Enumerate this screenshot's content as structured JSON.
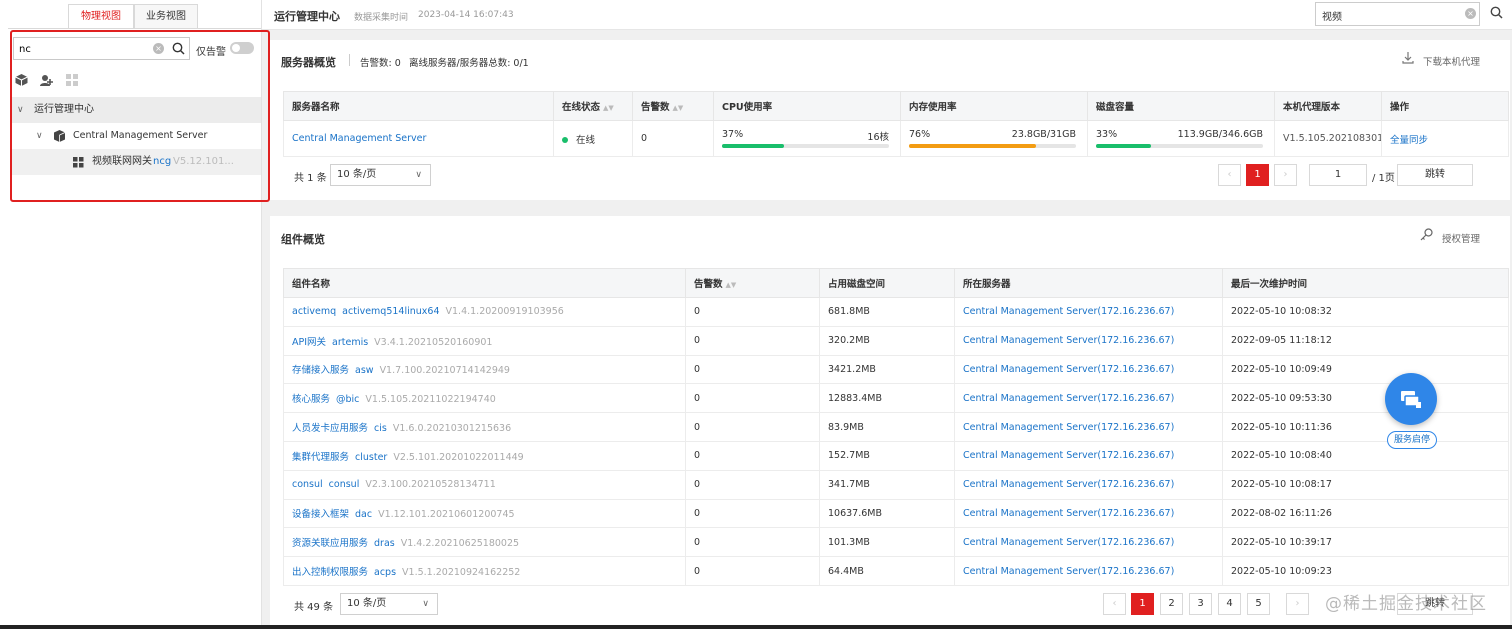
{
  "sidebar": {
    "tabs": [
      {
        "label": "物理视图",
        "active": true
      },
      {
        "label": "业务视图",
        "active": false
      }
    ],
    "search_value": "nc",
    "alert_only_label": "仅告警",
    "tree": {
      "root": "运行管理中心",
      "server": "Central Management Server",
      "gateway": {
        "name": "视频联网网关",
        "code": "ncg",
        "version": "V5.12.101..."
      }
    }
  },
  "header": {
    "title": "运行管理中心",
    "time_label": "数据采集时间",
    "time_value": "2023-04-14 16:07:43",
    "search_value": "视频"
  },
  "server_overview": {
    "title": "服务器概览",
    "alert_count": "告警数: 0",
    "offline_count": "离线服务器/服务器总数: 0/1",
    "download_label": "下载本机代理",
    "columns": [
      "服务器名称",
      "在线状态",
      "告警数",
      "CPU使用率",
      "内存使用率",
      "磁盘容量",
      "本机代理版本",
      "操作"
    ],
    "row": {
      "name": "Central Management Server",
      "status": "在线",
      "alerts": "0",
      "cpu_pct": "37%",
      "cpu_detail": "16核",
      "cpu_value": 0.37,
      "mem_pct": "76%",
      "mem_detail": "23.8GB/31GB",
      "mem_value": 0.76,
      "disk_pct": "33%",
      "disk_detail": "113.9GB/346.6GB",
      "disk_value": 0.33,
      "agent_version": "V1.5.105.202108301...",
      "action": "全量同步"
    },
    "total": "共 1 条",
    "page_size": "10 条/页",
    "current_page": "1",
    "goto_value": "1",
    "total_pages": "/ 1页",
    "goto_label": "跳转"
  },
  "component_overview": {
    "title": "组件概览",
    "license_label": "授权管理",
    "columns": [
      "组件名称",
      "告警数",
      "占用磁盘空间",
      "所在服务器",
      "最后一次维护时间"
    ],
    "rows": [
      {
        "name": "activemq",
        "module": "activemq514linux64",
        "version": "V1.4.1.20200919103956",
        "alerts": "0",
        "disk": "681.8MB",
        "server": "Central Management Server(172.16.236.67)",
        "time": "2022-05-10 10:08:32"
      },
      {
        "name": "API网关",
        "module": "artemis",
        "version": "V3.4.1.20210520160901",
        "alerts": "0",
        "disk": "320.2MB",
        "server": "Central Management Server(172.16.236.67)",
        "time": "2022-09-05 11:18:12"
      },
      {
        "name": "存储接入服务",
        "module": "asw",
        "version": "V1.7.100.20210714142949",
        "alerts": "0",
        "disk": "3421.2MB",
        "server": "Central Management Server(172.16.236.67)",
        "time": "2022-05-10 10:09:49"
      },
      {
        "name": "核心服务",
        "module": "@bic",
        "version": "V1.5.105.20211022194740",
        "alerts": "0",
        "disk": "12883.4MB",
        "server": "Central Management Server(172.16.236.67)",
        "time": "2022-05-10 09:53:30"
      },
      {
        "name": "人员发卡应用服务",
        "module": "cis",
        "version": "V1.6.0.20210301215636",
        "alerts": "0",
        "disk": "83.9MB",
        "server": "Central Management Server(172.16.236.67)",
        "time": "2022-05-10 10:11:36"
      },
      {
        "name": "集群代理服务",
        "module": "cluster",
        "version": "V2.5.101.20201022011449",
        "alerts": "0",
        "disk": "152.7MB",
        "server": "Central Management Server(172.16.236.67)",
        "time": "2022-05-10 10:08:40"
      },
      {
        "name": "consul",
        "module": "consul",
        "version": "V2.3.100.20210528134711",
        "alerts": "0",
        "disk": "341.7MB",
        "server": "Central Management Server(172.16.236.67)",
        "time": "2022-05-10 10:08:17"
      },
      {
        "name": "设备接入框架",
        "module": "dac",
        "version": "V1.12.101.20210601200745",
        "alerts": "0",
        "disk": "10637.6MB",
        "server": "Central Management Server(172.16.236.67)",
        "time": "2022-08-02 16:11:26"
      },
      {
        "name": "资源关联应用服务",
        "module": "dras",
        "version": "V1.4.2.20210625180025",
        "alerts": "0",
        "disk": "101.3MB",
        "server": "Central Management Server(172.16.236.67)",
        "time": "2022-05-10 10:39:17"
      },
      {
        "name": "出入控制权限服务",
        "module": "acps",
        "version": "V1.5.1.20210924162252",
        "alerts": "0",
        "disk": "64.4MB",
        "server": "Central Management Server(172.16.236.67)",
        "time": "2022-05-10 10:09:23"
      }
    ],
    "total": "共 49 条",
    "page_size": "10 条/页",
    "pages": [
      "1",
      "2",
      "3",
      "4",
      "5"
    ],
    "current_page": "1",
    "goto_label": "跳转"
  },
  "fab": {
    "label": "服务启停"
  },
  "watermark": "@稀土掘金技术社区",
  "colors": {
    "accent_red": "#e02020",
    "link_blue": "#1a73c8",
    "cpu_bar": "#19be6b",
    "mem_bar": "#f39c12",
    "disk_bar": "#19be6b",
    "online_dot": "#19be6b"
  }
}
